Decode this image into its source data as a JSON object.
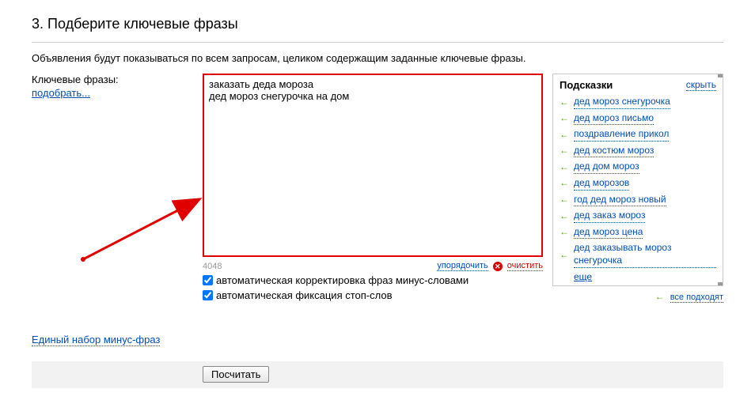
{
  "section": {
    "number": "3.",
    "title": "Подберите ключевые фразы"
  },
  "intro": "Объявления будут показываться по всем запросам, целиком содержащим заданные ключевые фразы.",
  "labels": {
    "keywords": "Ключевые фразы:",
    "pick": "подобрать..."
  },
  "textarea": {
    "value": "заказать деда мороза\nдед мороз снегурочка на дом",
    "counter": "4048"
  },
  "links": {
    "sort": "упорядочить",
    "clear": "очистить",
    "minus_set": "Единый набор минус-фраз",
    "hide": "скрыть",
    "more": "еще",
    "all_fit": "все подходят"
  },
  "checkboxes": {
    "auto_correct": "автоматическая корректировка фраз минус-словами",
    "auto_stop": "автоматическая фиксация стоп-слов"
  },
  "hints": {
    "title": "Подсказки",
    "items": [
      "дед мороз снегурочка",
      "дед мороз письмо",
      "поздравление прикол",
      "дед костюм мороз",
      "дед дом мороз",
      "дед морозов",
      "год дед мороз новый",
      "дед заказ мороз",
      "дед мороз цена",
      "дед заказывать мороз снегурочка"
    ]
  },
  "buttons": {
    "calc": "Посчитать"
  }
}
